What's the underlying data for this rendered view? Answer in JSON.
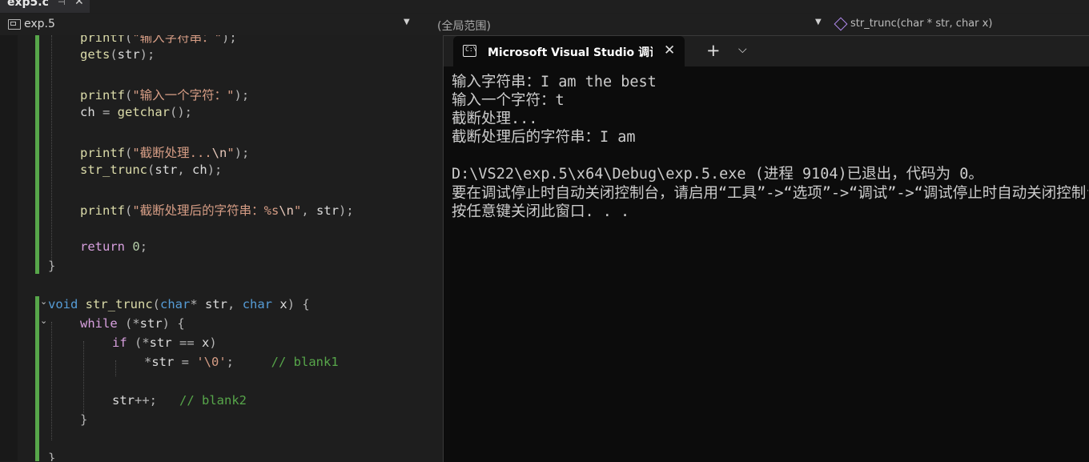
{
  "editor": {
    "file_tab": "exp5.c",
    "pin_icon": "pin-icon",
    "nav_project": "exp.5",
    "nav_scope": "(全局范围)",
    "nav_function": "str_trunc(char * str, char x)"
  },
  "code_lines": [
    [
      [
        "printf",
        "fn"
      ],
      [
        "(",
        "p"
      ],
      [
        "\"输入字符串：\"",
        "str"
      ],
      [
        ");",
        "p"
      ]
    ],
    [
      [
        "gets",
        "fn"
      ],
      [
        "(",
        "p"
      ],
      [
        "str",
        "id"
      ],
      [
        ");",
        "p"
      ]
    ],
    [],
    [
      [
        "printf",
        "fn"
      ],
      [
        "(",
        "p"
      ],
      [
        "\"输入一个字符：\"",
        "str"
      ],
      [
        ");",
        "p"
      ]
    ],
    [
      [
        "ch",
        "id"
      ],
      [
        " = ",
        "p"
      ],
      [
        "getchar",
        "fn"
      ],
      [
        "();",
        "p"
      ]
    ],
    [],
    [
      [
        "printf",
        "fn"
      ],
      [
        "(",
        "p"
      ],
      [
        "\"截断处理...",
        "str"
      ],
      [
        "\\n",
        "esc"
      ],
      [
        "\"",
        "str"
      ],
      [
        ");",
        "p"
      ]
    ],
    [
      [
        "str_trunc",
        "fn"
      ],
      [
        "(",
        "p"
      ],
      [
        "str",
        "id"
      ],
      [
        ", ",
        "p"
      ],
      [
        "ch",
        "id"
      ],
      [
        ");",
        "p"
      ]
    ],
    [],
    [
      [
        "printf",
        "fn"
      ],
      [
        "(",
        "p"
      ],
      [
        "\"截断处理后的字符串：%s",
        "str"
      ],
      [
        "\\n",
        "esc"
      ],
      [
        "\"",
        "str"
      ],
      [
        ", ",
        "p"
      ],
      [
        "str",
        "id"
      ],
      [
        ");",
        "p"
      ]
    ],
    [],
    [
      [
        "return",
        "ctl"
      ],
      [
        " ",
        "p"
      ],
      [
        "0",
        "num"
      ],
      [
        ";",
        "p"
      ]
    ],
    [
      [
        "}",
        "p"
      ]
    ],
    [],
    [
      [
        "void",
        "kw"
      ],
      [
        " ",
        "p"
      ],
      [
        "str_trunc",
        "fn"
      ],
      [
        "(",
        "p"
      ],
      [
        "char",
        "kw"
      ],
      [
        "* ",
        "p"
      ],
      [
        "str",
        "id"
      ],
      [
        ", ",
        "p"
      ],
      [
        "char",
        "kw"
      ],
      [
        " ",
        "p"
      ],
      [
        "x",
        "id"
      ],
      [
        ") {",
        "p"
      ]
    ],
    [
      [
        "while",
        "ctl"
      ],
      [
        " (*",
        "p"
      ],
      [
        "str",
        "id"
      ],
      [
        ") {",
        "p"
      ]
    ],
    [
      [
        "if",
        "ctl"
      ],
      [
        " (*",
        "p"
      ],
      [
        "str",
        "id"
      ],
      [
        " == ",
        "p"
      ],
      [
        "x",
        "id"
      ],
      [
        ")",
        "p"
      ]
    ],
    [
      [
        "*",
        "p"
      ],
      [
        "str",
        "id"
      ],
      [
        " = ",
        "p"
      ],
      [
        "'\\0'",
        "str"
      ],
      [
        ";     ",
        "p"
      ],
      [
        "// blank1",
        "cm"
      ]
    ],
    [],
    [
      [
        "str",
        "id"
      ],
      [
        "++;   ",
        "p"
      ],
      [
        "// blank2",
        "cm"
      ]
    ],
    [
      [
        "}",
        "p"
      ]
    ],
    [],
    [
      [
        "}",
        "p"
      ]
    ]
  ],
  "terminal": {
    "tab_title": "Microsoft Visual Studio 调试控制台",
    "icon": "console-icon",
    "plus": "+",
    "caret": "⌵",
    "close": "✕",
    "lines": [
      "输入字符串：I am the best",
      "输入一个字符：t",
      "截断处理...",
      "截断处理后的字符串：I am",
      "",
      "D:\\VS22\\exp.5\\x64\\Debug\\exp.5.exe (进程 9104)已退出，代码为 0。",
      "要在调试停止时自动关闭控制台，请启用“工具”->“选项”->“调试”->“调试停止时自动关闭控制台”。",
      "按任意键关闭此窗口. . ."
    ]
  },
  "theme": {
    "keyword": "#569cd6",
    "control": "#d8a0df",
    "string": "#d69d85",
    "comment": "#57a64a",
    "function": "#dcdcaa",
    "background": "#1e1e1e",
    "console_bg": "#0c0c0c"
  }
}
